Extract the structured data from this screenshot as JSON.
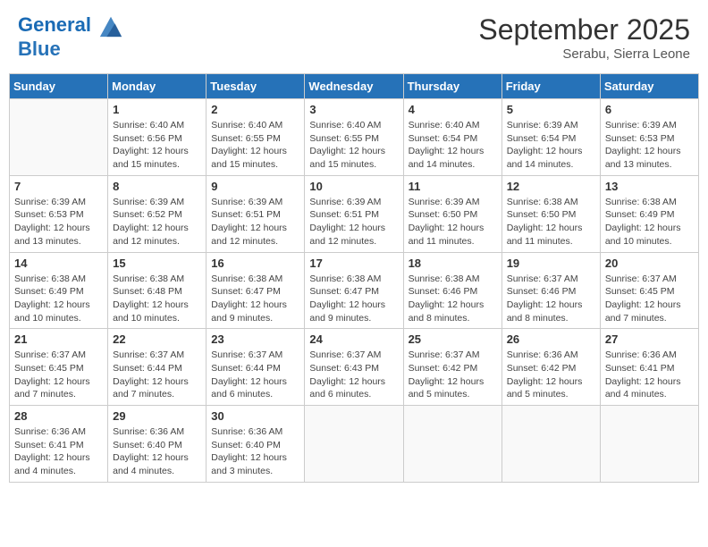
{
  "header": {
    "logo_line1": "General",
    "logo_line2": "Blue",
    "month": "September 2025",
    "location": "Serabu, Sierra Leone"
  },
  "weekdays": [
    "Sunday",
    "Monday",
    "Tuesday",
    "Wednesday",
    "Thursday",
    "Friday",
    "Saturday"
  ],
  "weeks": [
    [
      {
        "day": "",
        "info": ""
      },
      {
        "day": "1",
        "info": "Sunrise: 6:40 AM\nSunset: 6:56 PM\nDaylight: 12 hours\nand 15 minutes."
      },
      {
        "day": "2",
        "info": "Sunrise: 6:40 AM\nSunset: 6:55 PM\nDaylight: 12 hours\nand 15 minutes."
      },
      {
        "day": "3",
        "info": "Sunrise: 6:40 AM\nSunset: 6:55 PM\nDaylight: 12 hours\nand 15 minutes."
      },
      {
        "day": "4",
        "info": "Sunrise: 6:40 AM\nSunset: 6:54 PM\nDaylight: 12 hours\nand 14 minutes."
      },
      {
        "day": "5",
        "info": "Sunrise: 6:39 AM\nSunset: 6:54 PM\nDaylight: 12 hours\nand 14 minutes."
      },
      {
        "day": "6",
        "info": "Sunrise: 6:39 AM\nSunset: 6:53 PM\nDaylight: 12 hours\nand 13 minutes."
      }
    ],
    [
      {
        "day": "7",
        "info": "Sunrise: 6:39 AM\nSunset: 6:53 PM\nDaylight: 12 hours\nand 13 minutes."
      },
      {
        "day": "8",
        "info": "Sunrise: 6:39 AM\nSunset: 6:52 PM\nDaylight: 12 hours\nand 12 minutes."
      },
      {
        "day": "9",
        "info": "Sunrise: 6:39 AM\nSunset: 6:51 PM\nDaylight: 12 hours\nand 12 minutes."
      },
      {
        "day": "10",
        "info": "Sunrise: 6:39 AM\nSunset: 6:51 PM\nDaylight: 12 hours\nand 12 minutes."
      },
      {
        "day": "11",
        "info": "Sunrise: 6:39 AM\nSunset: 6:50 PM\nDaylight: 12 hours\nand 11 minutes."
      },
      {
        "day": "12",
        "info": "Sunrise: 6:38 AM\nSunset: 6:50 PM\nDaylight: 12 hours\nand 11 minutes."
      },
      {
        "day": "13",
        "info": "Sunrise: 6:38 AM\nSunset: 6:49 PM\nDaylight: 12 hours\nand 10 minutes."
      }
    ],
    [
      {
        "day": "14",
        "info": "Sunrise: 6:38 AM\nSunset: 6:49 PM\nDaylight: 12 hours\nand 10 minutes."
      },
      {
        "day": "15",
        "info": "Sunrise: 6:38 AM\nSunset: 6:48 PM\nDaylight: 12 hours\nand 10 minutes."
      },
      {
        "day": "16",
        "info": "Sunrise: 6:38 AM\nSunset: 6:47 PM\nDaylight: 12 hours\nand 9 minutes."
      },
      {
        "day": "17",
        "info": "Sunrise: 6:38 AM\nSunset: 6:47 PM\nDaylight: 12 hours\nand 9 minutes."
      },
      {
        "day": "18",
        "info": "Sunrise: 6:38 AM\nSunset: 6:46 PM\nDaylight: 12 hours\nand 8 minutes."
      },
      {
        "day": "19",
        "info": "Sunrise: 6:37 AM\nSunset: 6:46 PM\nDaylight: 12 hours\nand 8 minutes."
      },
      {
        "day": "20",
        "info": "Sunrise: 6:37 AM\nSunset: 6:45 PM\nDaylight: 12 hours\nand 7 minutes."
      }
    ],
    [
      {
        "day": "21",
        "info": "Sunrise: 6:37 AM\nSunset: 6:45 PM\nDaylight: 12 hours\nand 7 minutes."
      },
      {
        "day": "22",
        "info": "Sunrise: 6:37 AM\nSunset: 6:44 PM\nDaylight: 12 hours\nand 7 minutes."
      },
      {
        "day": "23",
        "info": "Sunrise: 6:37 AM\nSunset: 6:44 PM\nDaylight: 12 hours\nand 6 minutes."
      },
      {
        "day": "24",
        "info": "Sunrise: 6:37 AM\nSunset: 6:43 PM\nDaylight: 12 hours\nand 6 minutes."
      },
      {
        "day": "25",
        "info": "Sunrise: 6:37 AM\nSunset: 6:42 PM\nDaylight: 12 hours\nand 5 minutes."
      },
      {
        "day": "26",
        "info": "Sunrise: 6:36 AM\nSunset: 6:42 PM\nDaylight: 12 hours\nand 5 minutes."
      },
      {
        "day": "27",
        "info": "Sunrise: 6:36 AM\nSunset: 6:41 PM\nDaylight: 12 hours\nand 4 minutes."
      }
    ],
    [
      {
        "day": "28",
        "info": "Sunrise: 6:36 AM\nSunset: 6:41 PM\nDaylight: 12 hours\nand 4 minutes."
      },
      {
        "day": "29",
        "info": "Sunrise: 6:36 AM\nSunset: 6:40 PM\nDaylight: 12 hours\nand 4 minutes."
      },
      {
        "day": "30",
        "info": "Sunrise: 6:36 AM\nSunset: 6:40 PM\nDaylight: 12 hours\nand 3 minutes."
      },
      {
        "day": "",
        "info": ""
      },
      {
        "day": "",
        "info": ""
      },
      {
        "day": "",
        "info": ""
      },
      {
        "day": "",
        "info": ""
      }
    ]
  ]
}
